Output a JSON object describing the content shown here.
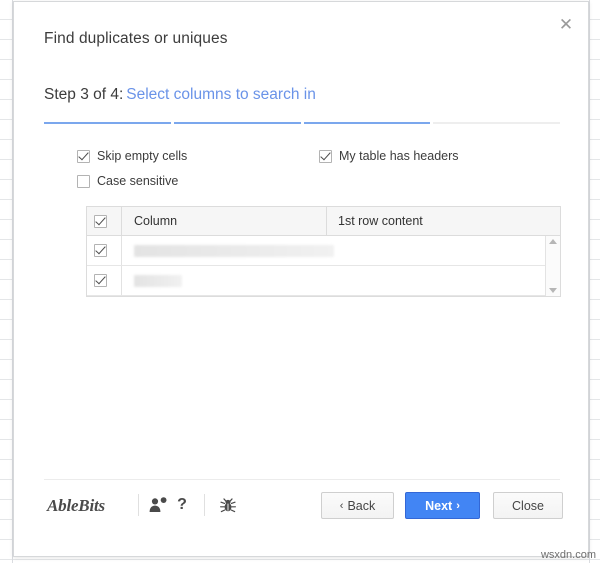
{
  "backdrop": {
    "name": "spreadsheet-grid"
  },
  "dialog": {
    "title": "Find duplicates or uniques",
    "close_label": "✕",
    "step": {
      "prefix": "Step 3 of 4:",
      "link": "Select columns to search in",
      "current": 3,
      "total": 4
    },
    "progress": {
      "segments": 4,
      "completed": 3,
      "done_color": "#7ba7ed",
      "todo_color": "#eeeeee"
    },
    "options": [
      {
        "id": "skip-empty-cells",
        "label": "Skip empty cells",
        "checked": true
      },
      {
        "id": "case-sensitive",
        "label": "Case sensitive",
        "checked": false
      },
      {
        "id": "my-table-has-headers",
        "label": "My table has headers",
        "checked": true
      }
    ],
    "table": {
      "select_all_checked": true,
      "headers": {
        "column": "Column",
        "first_row": "1st row content"
      },
      "rows": [
        {
          "checked": true,
          "column": "",
          "column_redacted": true,
          "redacted_width": 200,
          "first_row": ""
        },
        {
          "checked": true,
          "column": "",
          "column_redacted": true,
          "redacted_width": 48,
          "first_row": ""
        }
      ],
      "scrollbar": {
        "up": "scroll-up",
        "down": "scroll-down"
      }
    },
    "footer": {
      "brand": "AbleBits",
      "icons": [
        {
          "id": "feedback-icon",
          "title": "Feedback"
        },
        {
          "id": "help-icon",
          "title": "?"
        },
        {
          "id": "bug-icon",
          "title": "Report a bug"
        }
      ],
      "buttons": {
        "back": {
          "label": "Back",
          "chevron": "‹",
          "primary": false
        },
        "next": {
          "label": "Next",
          "chevron": "›",
          "primary": true
        },
        "close": {
          "label": "Close",
          "primary": false
        }
      }
    }
  },
  "watermark": "wsxdn.com",
  "colors": {
    "accent": "#4285f4",
    "link": "#6a93e8",
    "progress_done": "#7ba7ed"
  }
}
